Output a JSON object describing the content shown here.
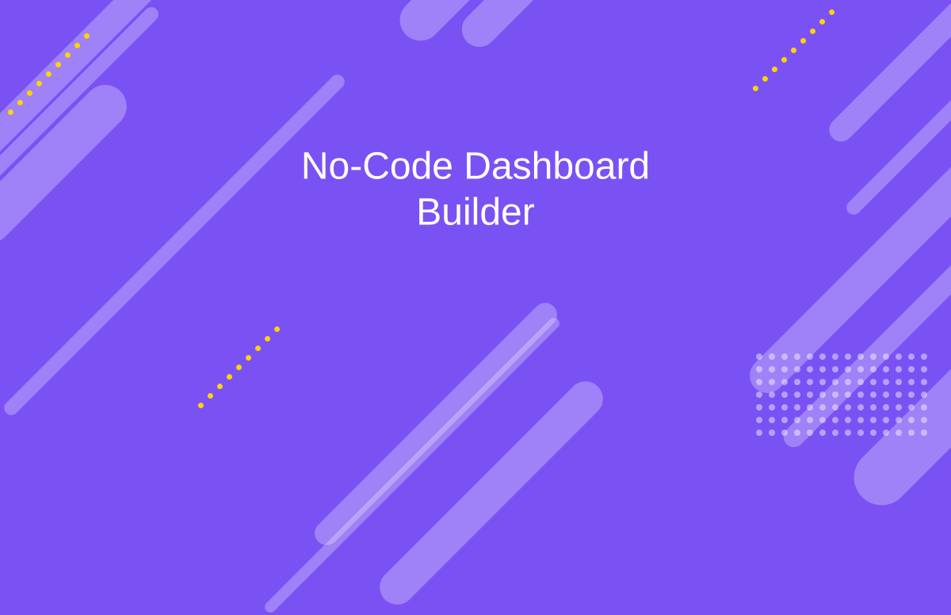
{
  "hero": {
    "title": "No-Code Dashboard\nBuilder"
  },
  "colors": {
    "background": "#7a52f4",
    "accent_dots": "#ffd400",
    "stripe_overlay": "rgba(255,255,255,0.28)"
  }
}
